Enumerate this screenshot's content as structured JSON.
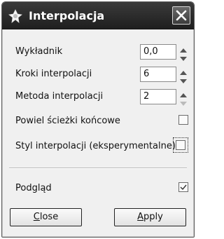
{
  "window": {
    "title": "Interpolacja",
    "close_label": "Close"
  },
  "fields": {
    "exponent": {
      "label": "Wykładnik",
      "value": "0,0"
    },
    "steps": {
      "label": "Kroki interpolacji",
      "value": "6"
    },
    "method": {
      "label": "Metoda interpolacji",
      "value": "2"
    }
  },
  "checks": {
    "repeat_end": {
      "label": "Powiel ścieżki końcowe",
      "checked": false
    },
    "style": {
      "label": "Styl interpolacji (eksperymentalne)",
      "checked": false
    },
    "preview": {
      "label": "Podgląd",
      "checked": true
    }
  },
  "buttons": {
    "close": {
      "mnemonic": "C",
      "rest": "lose"
    },
    "apply": {
      "mnemonic": "A",
      "rest": "pply"
    }
  },
  "icons": {
    "title": "gimp-fuzzy-icon",
    "close": "close-icon",
    "spin_up": "spin-up-icon",
    "spin_down": "spin-down-icon",
    "check": "checkmark-icon"
  }
}
